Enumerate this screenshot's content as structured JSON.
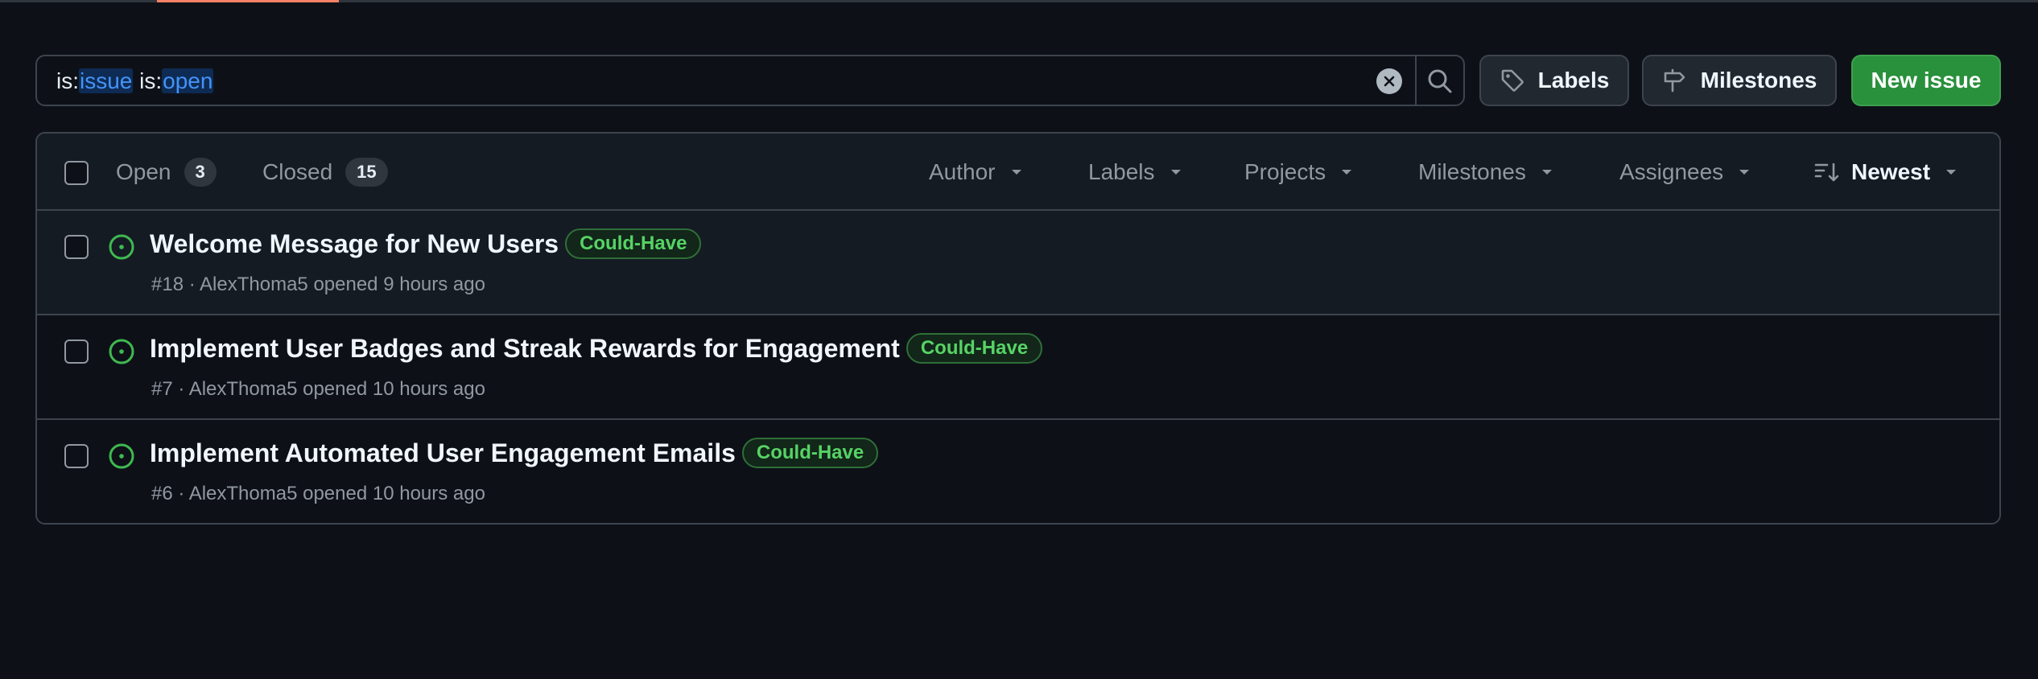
{
  "search": {
    "prefix1": "is:",
    "value1": "issue",
    "prefix2": " is:",
    "value2": "open"
  },
  "toolbar": {
    "labels_label": "Labels",
    "milestones_label": "Milestones",
    "new_issue_label": "New issue"
  },
  "states": {
    "open_label": "Open",
    "open_count": "3",
    "closed_label": "Closed",
    "closed_count": "15"
  },
  "filters": {
    "author": "Author",
    "labels": "Labels",
    "projects": "Projects",
    "milestones": "Milestones",
    "assignees": "Assignees",
    "sort": "Newest"
  },
  "issues": [
    {
      "title": "Welcome Message for New Users",
      "label": "Could-Have",
      "meta": "#18 · AlexThoma5 opened 9 hours ago"
    },
    {
      "title": "Implement User Badges and Streak Rewards for Engagement",
      "label": "Could-Have",
      "meta": "#7 · AlexThoma5 opened 10 hours ago"
    },
    {
      "title": "Implement Automated User Engagement Emails",
      "label": "Could-Have",
      "meta": "#6 · AlexThoma5 opened 10 hours ago"
    }
  ],
  "colors": {
    "background": "#0d1117",
    "open_icon": "#3fb950",
    "label_text": "#56d364",
    "new_button": "#29903b",
    "active_tab_underline": "#f78166"
  },
  "icons": {
    "clear": "x-circle-fill-icon",
    "search": "search-icon",
    "labels": "tag-icon",
    "milestones": "milestone-icon",
    "issue_open": "issue-opened-icon",
    "caret": "triangle-down-icon",
    "sort": "sort-desc-icon"
  }
}
